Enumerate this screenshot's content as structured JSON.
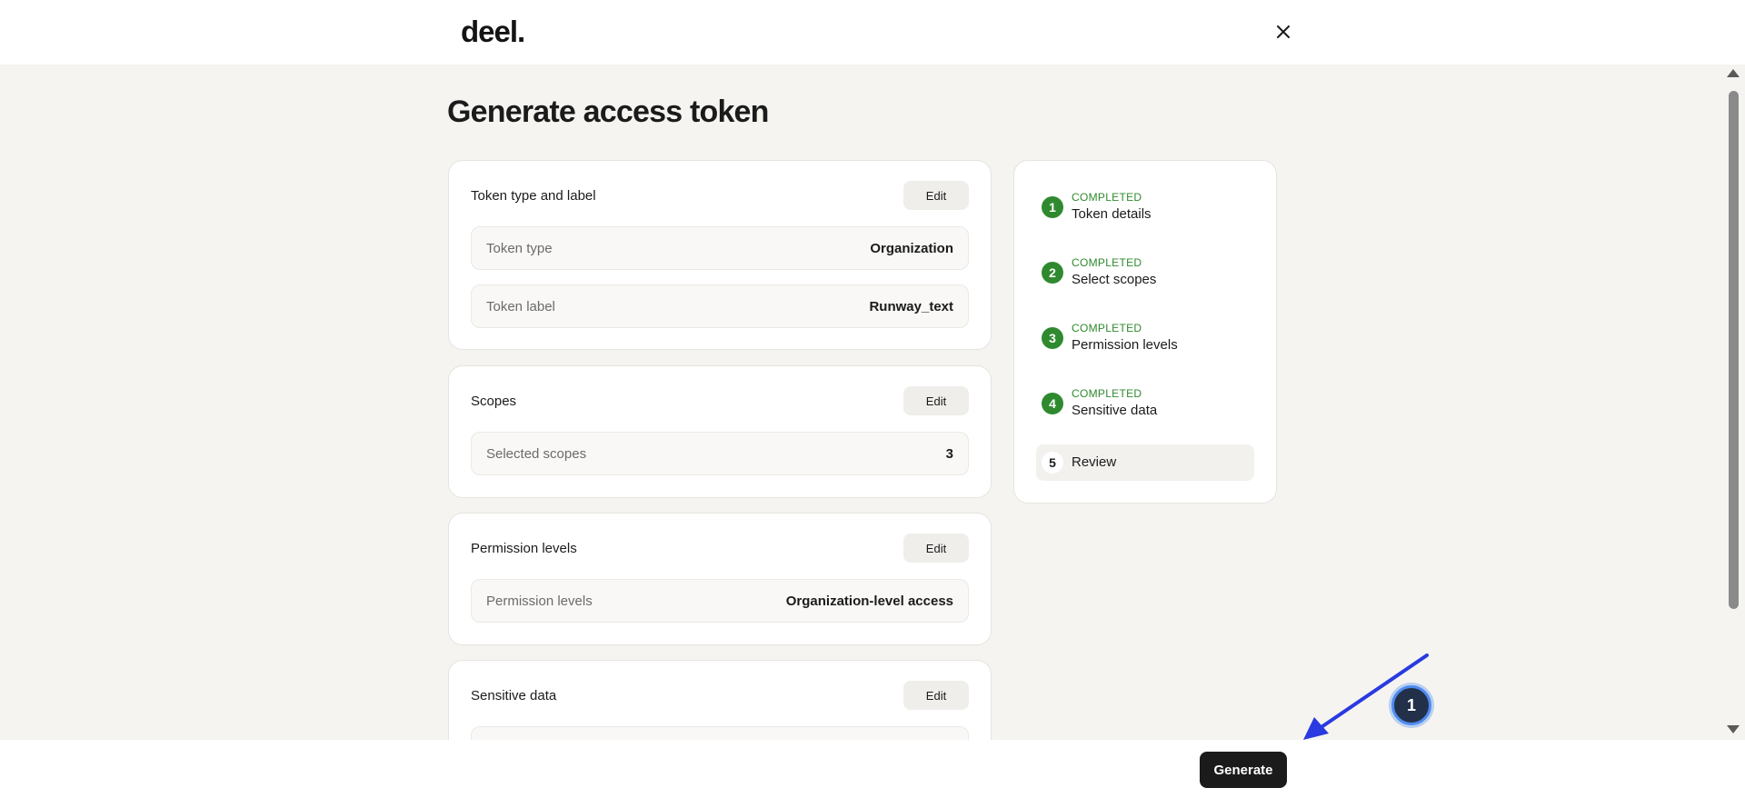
{
  "header": {
    "logo": "deel.",
    "close_icon": "close-icon"
  },
  "page": {
    "title": "Generate access token"
  },
  "cards": {
    "token": {
      "title": "Token type and label",
      "edit_label": "Edit",
      "rows": [
        {
          "label": "Token type",
          "value": "Organization"
        },
        {
          "label": "Token label",
          "value": "Runway_text"
        }
      ]
    },
    "scopes": {
      "title": "Scopes",
      "edit_label": "Edit",
      "rows": [
        {
          "label": "Selected scopes",
          "value": "3"
        }
      ]
    },
    "permissions": {
      "title": "Permission levels",
      "edit_label": "Edit",
      "rows": [
        {
          "label": "Permission levels",
          "value": "Organization-level access"
        }
      ]
    },
    "sensitive": {
      "title": "Sensitive data",
      "edit_label": "Edit"
    }
  },
  "stepper": {
    "steps": [
      {
        "number": "1",
        "status": "COMPLETED",
        "name": "Token details"
      },
      {
        "number": "2",
        "status": "COMPLETED",
        "name": "Select scopes"
      },
      {
        "number": "3",
        "status": "COMPLETED",
        "name": "Permission levels"
      },
      {
        "number": "4",
        "status": "COMPLETED",
        "name": "Sensitive data"
      },
      {
        "number": "5",
        "status": "",
        "name": "Review"
      }
    ],
    "completed_color": "#2f8a2f"
  },
  "footer": {
    "generate_label": "Generate"
  },
  "annotation": {
    "badge": "1",
    "arrow_color": "#2a3ae0"
  }
}
